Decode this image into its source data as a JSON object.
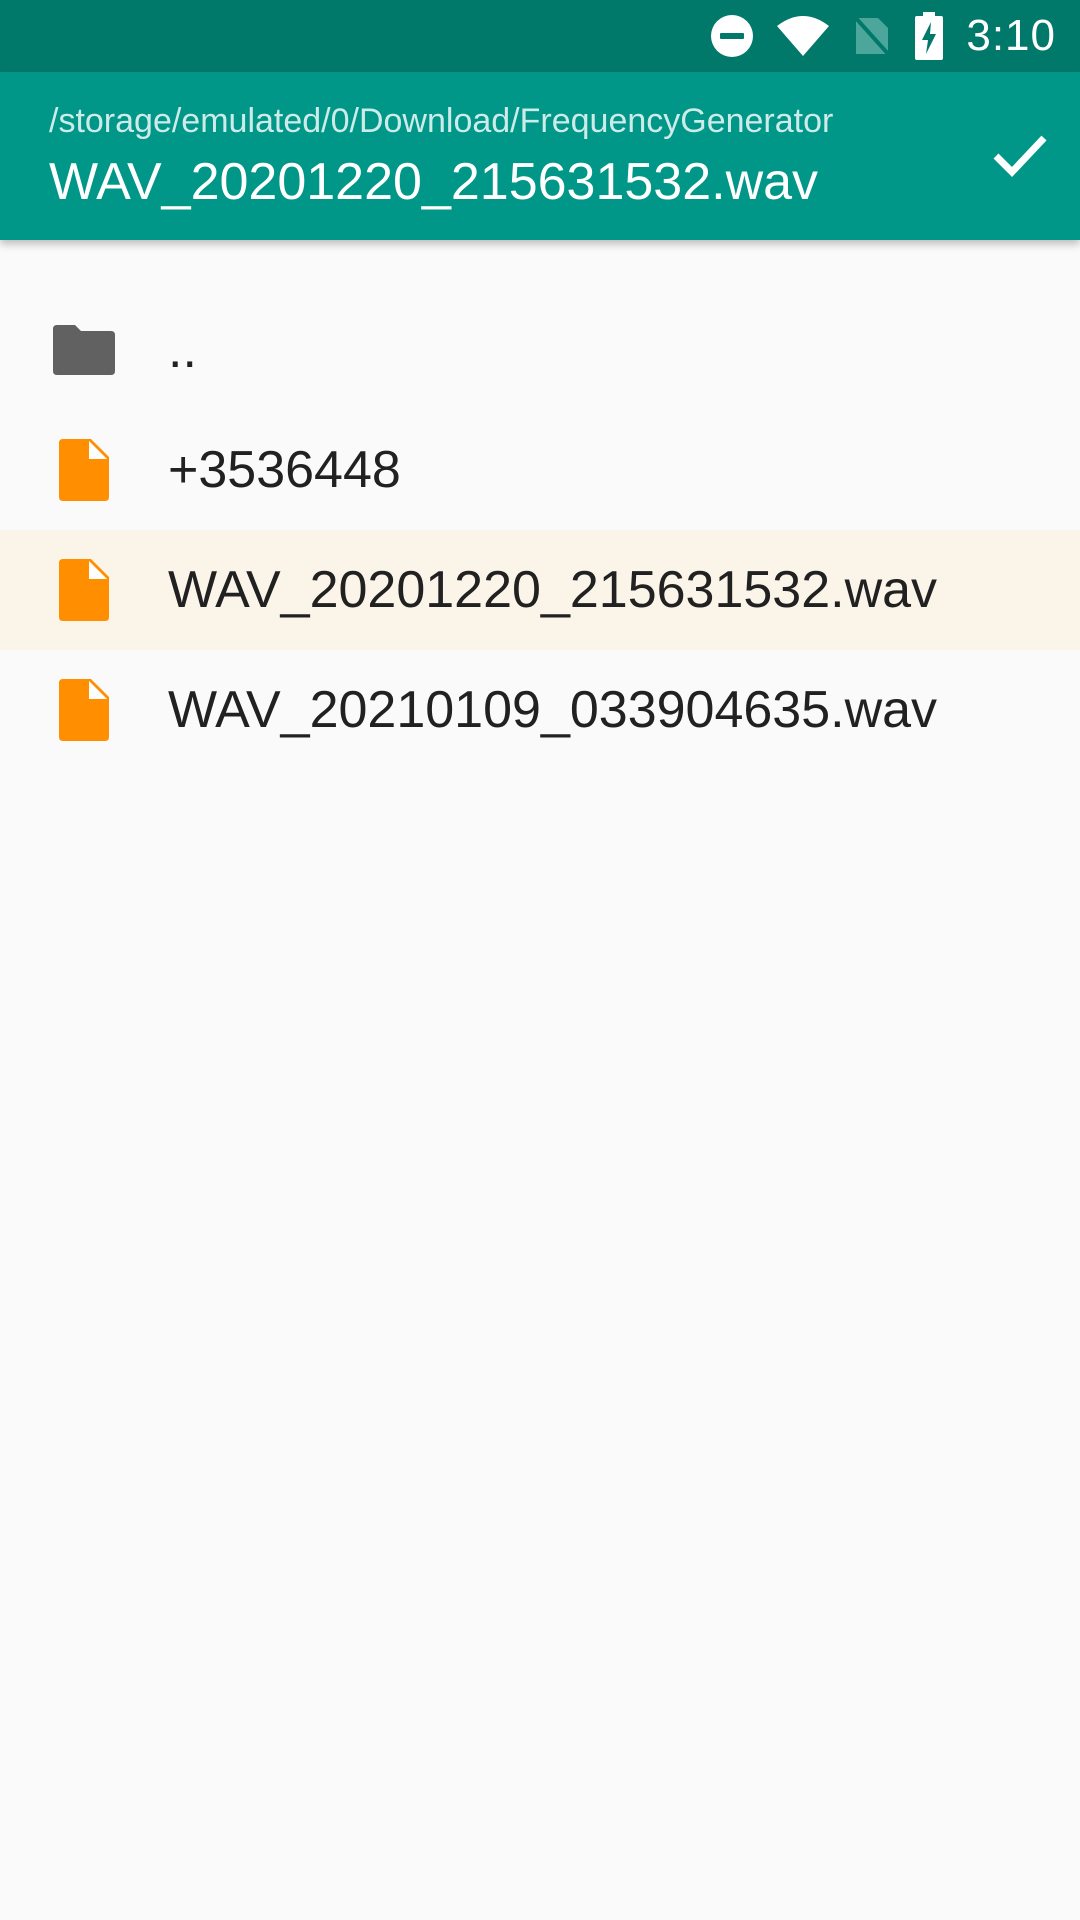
{
  "status_bar": {
    "time": "3:10",
    "icons": [
      "do-not-disturb-icon",
      "wifi-icon",
      "no-sim-icon",
      "battery-charging-icon"
    ]
  },
  "app_bar": {
    "path": "/storage/emulated/0/Download/FrequencyGenerator",
    "selected_name": "WAV_20201220_215631532.wav",
    "confirm_icon": "check-icon"
  },
  "files": [
    {
      "name": "..",
      "type": "folder",
      "icon": "folder-icon",
      "selected": false
    },
    {
      "name": "+3536448",
      "type": "file",
      "icon": "file-icon",
      "selected": false
    },
    {
      "name": "WAV_20201220_215631532.wav",
      "type": "file",
      "icon": "file-icon",
      "selected": true
    },
    {
      "name": "WAV_20210109_033904635.wav",
      "type": "file",
      "icon": "file-icon",
      "selected": false
    }
  ],
  "colors": {
    "status_bar": "#00796b",
    "app_bar": "#009688",
    "folder_icon": "#616161",
    "file_icon": "#ff8f00",
    "selected_row": "#fbf4e8"
  }
}
